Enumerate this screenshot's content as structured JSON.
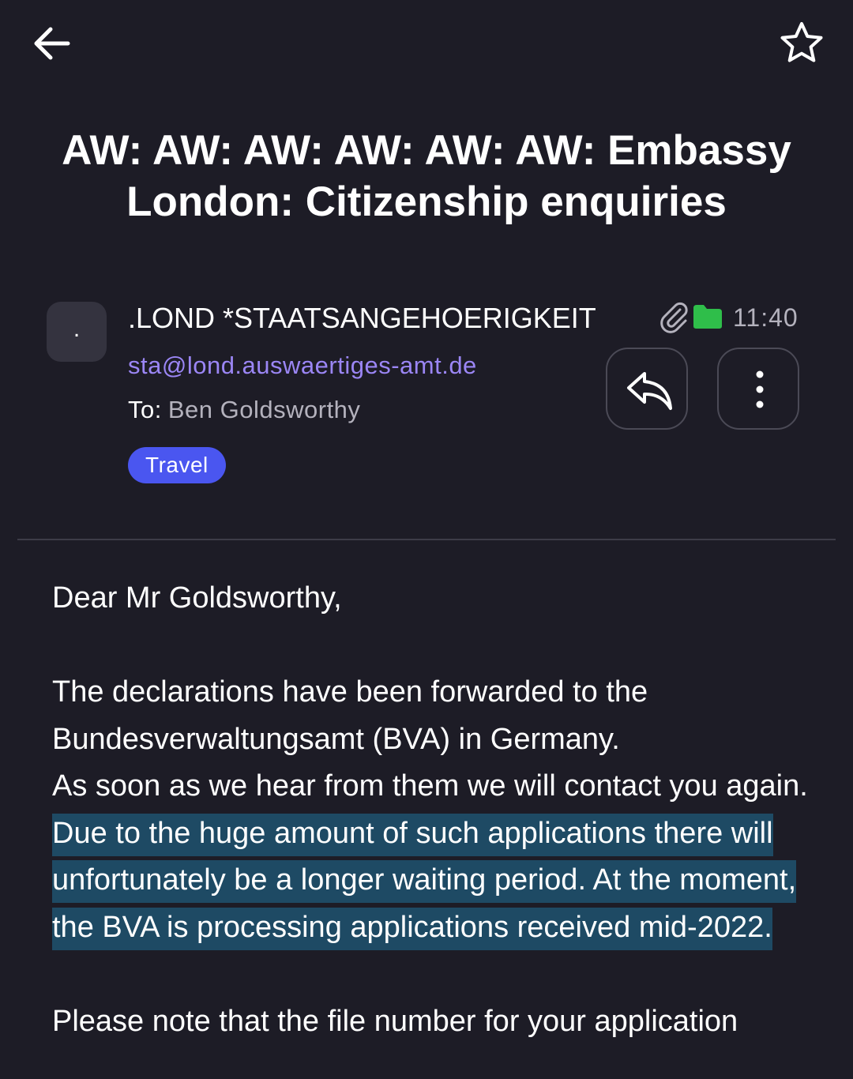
{
  "subject": "AW: AW: AW: AW: AW: AW: Embassy London: Citizenship enquiries",
  "sender": {
    "avatar_initial": ".",
    "name": ".LOND *STAATSANGEHOERIGKEIT",
    "email": "sta@lond.auswaertiges-amt.de",
    "time": "11:40"
  },
  "recipient": {
    "label": "To:",
    "value": "Ben Goldsworthy"
  },
  "tag": {
    "label": "Travel",
    "color": "#4a56f0"
  },
  "icons": {
    "back": "arrow-left-icon",
    "star": "star-outline-icon",
    "attachment": "paperclip-icon",
    "folder": "folder-icon",
    "reply": "reply-icon",
    "more": "more-vertical-icon"
  },
  "colors": {
    "background": "#1d1c26",
    "email_link": "#9b86f5",
    "folder": "#2fbe4a",
    "highlight": "#1e4a64"
  },
  "message": {
    "greeting": "Dear Mr Goldsworthy,",
    "paragraph1_line1": "The declarations have been forwarded to the",
    "paragraph1_line2": "Bundesverwaltungsamt (BVA) in Germany.",
    "paragraph2_plain": "As soon as we hear from them we will contact you again. ",
    "paragraph2_highlighted": "Due to the huge amount of such applications there will unfortunately be a longer waiting period. At the moment, the BVA is processing applications received mid-2022.",
    "paragraph3": "Please note that the file number for your application"
  }
}
